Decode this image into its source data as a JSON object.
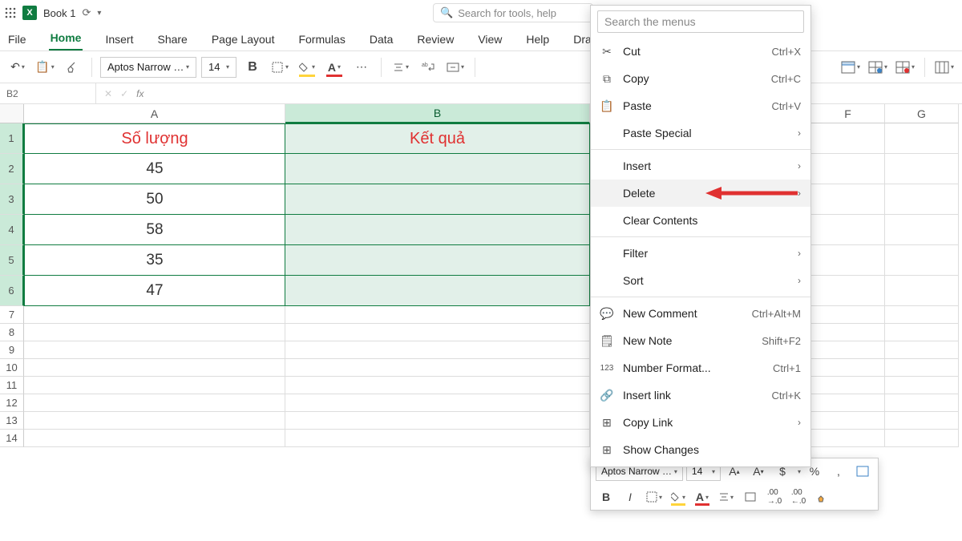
{
  "title": {
    "book": "Book 1",
    "search_placeholder": "Search for tools, help"
  },
  "menu": {
    "file": "File",
    "home": "Home",
    "insert": "Insert",
    "share": "Share",
    "pagelayout": "Page Layout",
    "formulas": "Formulas",
    "data": "Data",
    "review": "Review",
    "view": "View",
    "help": "Help",
    "draw": "Draw"
  },
  "ribbon": {
    "font": "Aptos Narrow …",
    "size": "14"
  },
  "formula": {
    "namebox": "B2",
    "fx": "fx"
  },
  "cols": {
    "A": "A",
    "B": "B",
    "F": "F",
    "G": "G"
  },
  "rows": [
    "1",
    "2",
    "3",
    "4",
    "5",
    "6",
    "7",
    "8",
    "9",
    "10",
    "11",
    "12",
    "13",
    "14"
  ],
  "table": {
    "headerA": "Số lượng",
    "headerB": "Kết quả",
    "valsA": [
      "45",
      "50",
      "58",
      "35",
      "47"
    ]
  },
  "ctx": {
    "search_placeholder": "Search the menus",
    "cut": {
      "label": "Cut",
      "sc": "Ctrl+X"
    },
    "copy": {
      "label": "Copy",
      "sc": "Ctrl+C"
    },
    "paste": {
      "label": "Paste",
      "sc": "Ctrl+V"
    },
    "pspecial": "Paste Special",
    "insert": "Insert",
    "delete": "Delete",
    "clear": "Clear Contents",
    "filter": "Filter",
    "sort": "Sort",
    "newcomment": {
      "label": "New Comment",
      "sc": "Ctrl+Alt+M"
    },
    "newnote": {
      "label": "New Note",
      "sc": "Shift+F2"
    },
    "numfmt": {
      "label": "Number Format...",
      "sc": "Ctrl+1"
    },
    "link": {
      "label": "Insert link",
      "sc": "Ctrl+K"
    },
    "copylink": "Copy Link",
    "showchanges": "Show Changes"
  },
  "mini": {
    "font": "Aptos Narrow …",
    "size": "14",
    "dollar": "$",
    "pct": "%",
    "comma": ","
  }
}
